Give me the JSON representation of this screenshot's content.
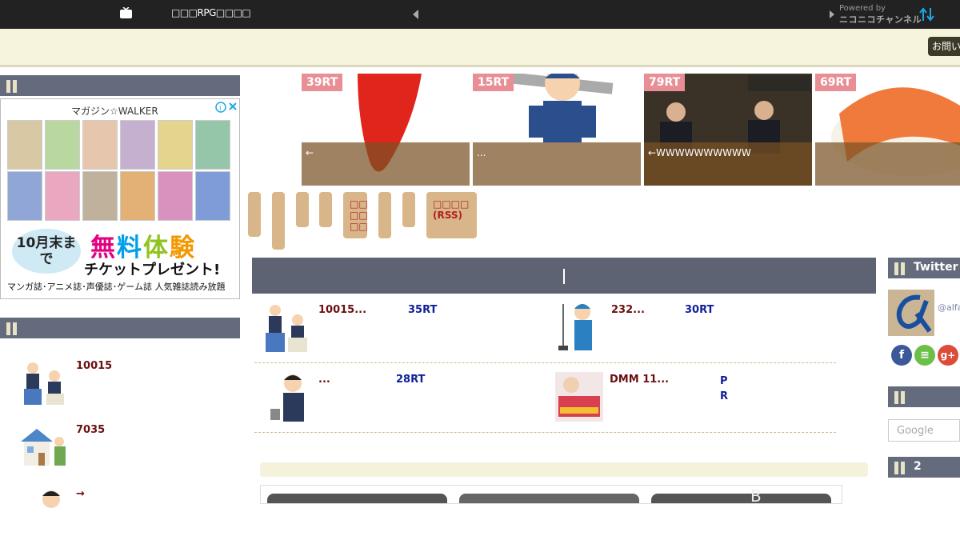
{
  "topbar": {
    "title": "□□□RPG□□□□",
    "powered_by": "Powered by",
    "channel": "ニコニコチャンネル"
  },
  "header": {
    "contact_button": "お問い"
  },
  "left_sidebar": {
    "section1_title": "",
    "ad": {
      "brand": "マガジン☆WALKER",
      "promo_bubble": "10月末まで",
      "promo_free": [
        "無",
        "料",
        "体",
        "験"
      ],
      "promo_ticket": "チケットプレゼント!",
      "footer": "マンガ誌･アニメ誌･声優誌･ゲーム誌 人気雑誌読み放題"
    },
    "section2_title": "",
    "items": [
      {
        "text": "10015"
      },
      {
        "text": "7035"
      },
      {
        "text": "→"
      }
    ]
  },
  "slider": {
    "slides": [
      {
        "rt": "39RT",
        "caption": "←"
      },
      {
        "rt": "15RT",
        "caption": "..."
      },
      {
        "rt": "79RT",
        "caption": "←WWWWWWWWWW"
      },
      {
        "rt": "69RT",
        "caption": ""
      }
    ]
  },
  "tabs": {
    "rss_label_top": "□□□□",
    "rss_label_bottom": "(RSS)",
    "stacked_label": "□□ □□ □□"
  },
  "feed": {
    "entries": [
      {
        "title": "10015...",
        "rt": "35RT"
      },
      {
        "title": "232...",
        "rt": "30RT"
      },
      {
        "title": "...",
        "rt": "28RT"
      },
      {
        "title": "DMM 11...",
        "rt": "P\nR"
      }
    ]
  },
  "right_sidebar": {
    "twitter_title": "Twitter",
    "handle": "@alfa",
    "social": [
      "f",
      "≡",
      "g+"
    ],
    "section_title": "",
    "search_placeholder": "Google",
    "section3_title": "2"
  },
  "colors": {
    "topbar": "#222222",
    "section_header": "#646b7c",
    "cream": "#f7f4dd",
    "rt_badge": "#e88f96",
    "tab": "#d9b68a",
    "link_title": "#6a1010",
    "link_rt": "#10209a"
  },
  "icons": [
    "tv-icon",
    "triangle-left-icon",
    "triangle-right-icon",
    "sort-arrows-icon",
    "ad-info-icon",
    "ad-close-icon",
    "facebook-icon",
    "feedly-icon",
    "google-plus-icon"
  ]
}
